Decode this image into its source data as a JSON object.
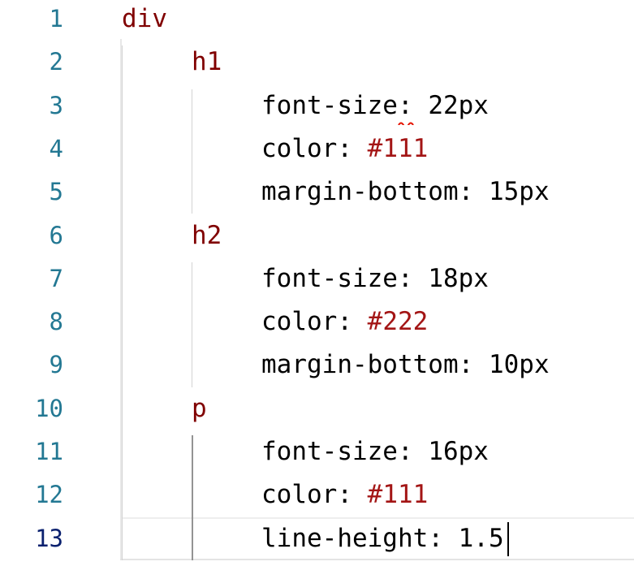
{
  "editor": {
    "active_line": 13,
    "lines": [
      {
        "number": "1",
        "indent": 0,
        "selector": "div"
      },
      {
        "number": "2",
        "indent": 1,
        "selector": "h1"
      },
      {
        "number": "3",
        "indent": 2,
        "property": "font-size",
        "separator": ": ",
        "value": "22px"
      },
      {
        "number": "4",
        "indent": 2,
        "property": "color",
        "separator": ": ",
        "value_hex": "#111"
      },
      {
        "number": "5",
        "indent": 2,
        "property": "margin-bottom",
        "separator": ": ",
        "value": "15px"
      },
      {
        "number": "6",
        "indent": 1,
        "selector": "h2"
      },
      {
        "number": "7",
        "indent": 2,
        "property": "font-size",
        "separator": ": ",
        "value": "18px"
      },
      {
        "number": "8",
        "indent": 2,
        "property": "color",
        "separator": ": ",
        "value_hex": "#222"
      },
      {
        "number": "9",
        "indent": 2,
        "property": "margin-bottom",
        "separator": ": ",
        "value": "10px"
      },
      {
        "number": "10",
        "indent": 1,
        "selector": "p"
      },
      {
        "number": "11",
        "indent": 2,
        "property": "font-size",
        "separator": ": ",
        "value": "16px"
      },
      {
        "number": "12",
        "indent": 2,
        "property": "color",
        "separator": ": ",
        "value_hex": "#111"
      },
      {
        "number": "13",
        "indent": 2,
        "property": "line-height",
        "separator": ": ",
        "value": "1.5"
      }
    ]
  },
  "colors": {
    "line_number": "#237893",
    "line_number_active": "#0b216f",
    "selector": "#800000",
    "hex_value": "#a31515",
    "text": "#000000",
    "squiggle": "#e51400"
  }
}
